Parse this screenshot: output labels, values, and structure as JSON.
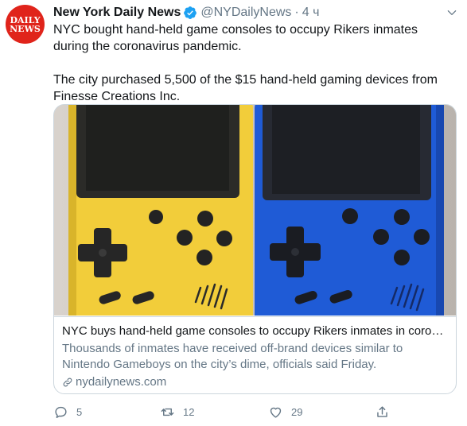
{
  "avatar": {
    "line1": "DAILY",
    "line2": "NEWS"
  },
  "tweet": {
    "author_name": "New York Daily News",
    "handle": "@NYDailyNews",
    "separator": "·",
    "time": "4 ч",
    "paragraphs": [
      "NYC bought hand-held game consoles to occupy Rikers inmates during the coronavirus pandemic.",
      "The city purchased 5,500 of the $15 hand-held gaming devices from Finesse Creations Inc."
    ]
  },
  "card": {
    "title": "NYC buys hand-held game consoles to occupy Rikers inmates in coronavirus pandemic",
    "description": "Thousands of inmates have received off-brand devices similar to Nintendo Gameboys on the city’s dime, officials said Friday.",
    "domain": "nydailynews.com"
  },
  "actions": {
    "replies": "5",
    "retweets": "12",
    "likes": "29"
  },
  "icons": {
    "verified": "verified-badge-icon",
    "caret": "chevron-down-icon",
    "reply": "reply-icon",
    "retweet": "retweet-icon",
    "like": "heart-icon",
    "share": "share-icon",
    "link": "link-icon"
  },
  "colors": {
    "brand_red": "#e0241b",
    "twitter_blue": "#1da1f2",
    "console_yellow": "#f2cd3a",
    "console_blue": "#1f5bd6",
    "secondary_text": "#657786"
  }
}
